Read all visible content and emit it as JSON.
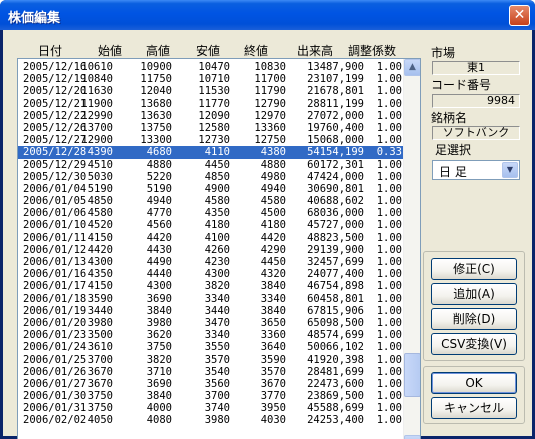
{
  "window": {
    "title": "株価編集",
    "close_glyph": "✕"
  },
  "columns": [
    "日付",
    "始値",
    "高値",
    "安値",
    "終値",
    "出来高",
    "調整係数"
  ],
  "rows": [
    [
      "2005/12/16",
      "10610",
      "10900",
      "10470",
      "10830",
      "13487,900",
      "1.00"
    ],
    [
      "2005/12/19",
      "10840",
      "11750",
      "10710",
      "11700",
      "23107,199",
      "1.00"
    ],
    [
      "2005/12/20",
      "11630",
      "12040",
      "11530",
      "11790",
      "21678,801",
      "1.00"
    ],
    [
      "2005/12/21",
      "11900",
      "13680",
      "11770",
      "12790",
      "28811,199",
      "1.00"
    ],
    [
      "2005/12/22",
      "12990",
      "13630",
      "12090",
      "12970",
      "27072,000",
      "1.00"
    ],
    [
      "2005/12/26",
      "13700",
      "13750",
      "12580",
      "13360",
      "19760,400",
      "1.00"
    ],
    [
      "2005/12/27",
      "12900",
      "13300",
      "12730",
      "12750",
      "15068,000",
      "1.00"
    ],
    [
      "2005/12/28",
      "4390",
      "4680",
      "4110",
      "4380",
      "54154,199",
      "0.33"
    ],
    [
      "2005/12/29",
      "4510",
      "4880",
      "4450",
      "4880",
      "60172,301",
      "1.00"
    ],
    [
      "2005/12/30",
      "5030",
      "5220",
      "4850",
      "4980",
      "47424,000",
      "1.00"
    ],
    [
      "2006/01/04",
      "5190",
      "5190",
      "4900",
      "4940",
      "30690,801",
      "1.00"
    ],
    [
      "2006/01/05",
      "4850",
      "4940",
      "4580",
      "4580",
      "40688,602",
      "1.00"
    ],
    [
      "2006/01/06",
      "4580",
      "4770",
      "4350",
      "4500",
      "68036,000",
      "1.00"
    ],
    [
      "2006/01/10",
      "4520",
      "4560",
      "4180",
      "4180",
      "45727,000",
      "1.00"
    ],
    [
      "2006/01/11",
      "4150",
      "4420",
      "4100",
      "4420",
      "48823,500",
      "1.00"
    ],
    [
      "2006/01/12",
      "4420",
      "4430",
      "4260",
      "4290",
      "29139,900",
      "1.00"
    ],
    [
      "2006/01/13",
      "4300",
      "4490",
      "4230",
      "4450",
      "32457,699",
      "1.00"
    ],
    [
      "2006/01/16",
      "4350",
      "4440",
      "4300",
      "4320",
      "24077,400",
      "1.00"
    ],
    [
      "2006/01/17",
      "4150",
      "4300",
      "3820",
      "3840",
      "46754,898",
      "1.00"
    ],
    [
      "2006/01/18",
      "3590",
      "3690",
      "3340",
      "3340",
      "60458,801",
      "1.00"
    ],
    [
      "2006/01/19",
      "3440",
      "3840",
      "3440",
      "3840",
      "67815,906",
      "1.00"
    ],
    [
      "2006/01/20",
      "3980",
      "3980",
      "3470",
      "3650",
      "65098,500",
      "1.00"
    ],
    [
      "2006/01/23",
      "3500",
      "3620",
      "3340",
      "3360",
      "48574,699",
      "1.00"
    ],
    [
      "2006/01/24",
      "3610",
      "3750",
      "3550",
      "3640",
      "50066,102",
      "1.00"
    ],
    [
      "2006/01/25",
      "3700",
      "3820",
      "3570",
      "3590",
      "41920,398",
      "1.00"
    ],
    [
      "2006/01/26",
      "3670",
      "3710",
      "3540",
      "3570",
      "28481,699",
      "1.00"
    ],
    [
      "2006/01/27",
      "3670",
      "3690",
      "3560",
      "3670",
      "22473,600",
      "1.00"
    ],
    [
      "2006/01/30",
      "3750",
      "3840",
      "3700",
      "3770",
      "23869,500",
      "1.00"
    ],
    [
      "2006/01/31",
      "3750",
      "4000",
      "3740",
      "3950",
      "45588,699",
      "1.00"
    ],
    [
      "2006/02/02",
      "4050",
      "4080",
      "3980",
      "4030",
      "24253,400",
      "1.00"
    ]
  ],
  "selected_row_index": 7,
  "scrollbar": {
    "up_glyph": "▲",
    "down_glyph": "▼",
    "thumb_position_fraction": 0.88
  },
  "side": {
    "market_label": "市場",
    "market_value": "東1",
    "code_label": "コード番号",
    "code_value": "9984",
    "name_label": "銘柄名",
    "name_value": "ソフトバンク",
    "ashi_label": "足選択",
    "ashi_value": "日 足",
    "ashi_arrow": "▼"
  },
  "buttons": {
    "edit": "修正(C)",
    "add": "追加(A)",
    "delete": "削除(D)",
    "csv": "CSV変換(V)",
    "ok": "OK",
    "cancel": "キャンセル"
  },
  "colors": {
    "selection": "#316ac5",
    "titlebar": "#0054e3",
    "dialog_bg": "#ece9d8"
  }
}
